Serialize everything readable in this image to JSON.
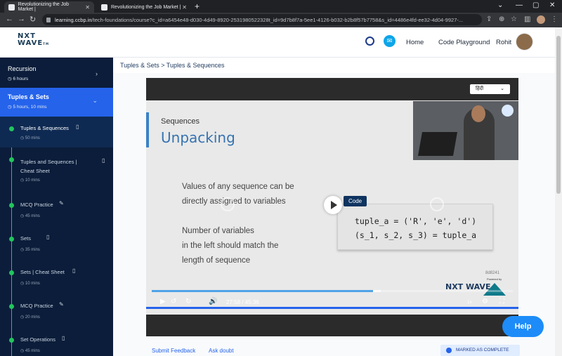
{
  "browser": {
    "tabs": [
      {
        "title": "Revolutionizing the Job Market |"
      },
      {
        "title": "Revolutionizing the Job Market |"
      }
    ],
    "url_host": "learning.ccbp.in",
    "url_rest": "/tech-foundations/course?c_id=a6454e48-d030-4d49-8920-2531980522328t_id=9d7b8f7a-5ee1-4126-b032-b2b8f57b7758&s_id=4486e4fd-ee32-4d04-9927-..."
  },
  "header": {
    "logo_line1": "NXT",
    "logo_line2": "WAVE",
    "logo_tm": "TM",
    "nav": [
      "Home",
      "Code Playground"
    ],
    "user_name": "Rohit"
  },
  "sidebar": {
    "modules": [
      {
        "title": "Recursion",
        "duration": "6 hours"
      },
      {
        "title": "Tuples & Sets",
        "duration": "5 hours, 10 mins"
      }
    ],
    "items": [
      {
        "title": "Tuples & Sequences",
        "duration": "50 mins",
        "icon": "book-icon"
      },
      {
        "title": "Tuples and Sequences | Cheat Sheet",
        "duration": "10 mins",
        "icon": "book-icon"
      },
      {
        "title": "MCQ Practice",
        "duration": "45 mins",
        "icon": "pencil-icon"
      },
      {
        "title": "Sets",
        "duration": "35 mins",
        "icon": "book-icon"
      },
      {
        "title": "Sets | Cheat Sheet",
        "duration": "10 mins",
        "icon": "book-icon"
      },
      {
        "title": "MCQ Practice",
        "duration": "20 mins",
        "icon": "pencil-icon"
      },
      {
        "title": "Set Operations",
        "duration": "45 mins",
        "icon": "book-icon"
      }
    ]
  },
  "breadcrumb": "Tuples & Sets > Tuples & Sequences",
  "video": {
    "language": "हिंदी",
    "slide_subtitle": "Sequences",
    "slide_title": "Unpacking",
    "body_1a": "Values of any sequence can be",
    "body_1b": "directly assigned to variables",
    "body_2a": "Number of variables",
    "body_2b": "in the left should match the",
    "body_2c": "length of sequence",
    "code_tag": "Code",
    "code_line1": "tuple_a = ('R', 'e', 'd')",
    "code_line2": "(s_1, s_2, s_3) = tuple_a",
    "video_id": "8d8241",
    "powered_by": "Powered by",
    "brand_mark": "NXT WAVE",
    "current_time": "27:58",
    "separator": "/",
    "total_time": "45:36",
    "speed": "1x",
    "progress_fraction": 0.613,
    "buffered_fraction": 0.635
  },
  "footer": {
    "submit_feedback": "Submit Feedback",
    "ask_doubt": "Ask doubt",
    "status": "MARKED AS COMPLETE"
  },
  "help_label": "Help",
  "colors": {
    "sidebar_bg": "#0b1d3a",
    "active_module": "#2563eb",
    "complete_green": "#22c55e",
    "accent_blue": "#1d8cf8"
  }
}
